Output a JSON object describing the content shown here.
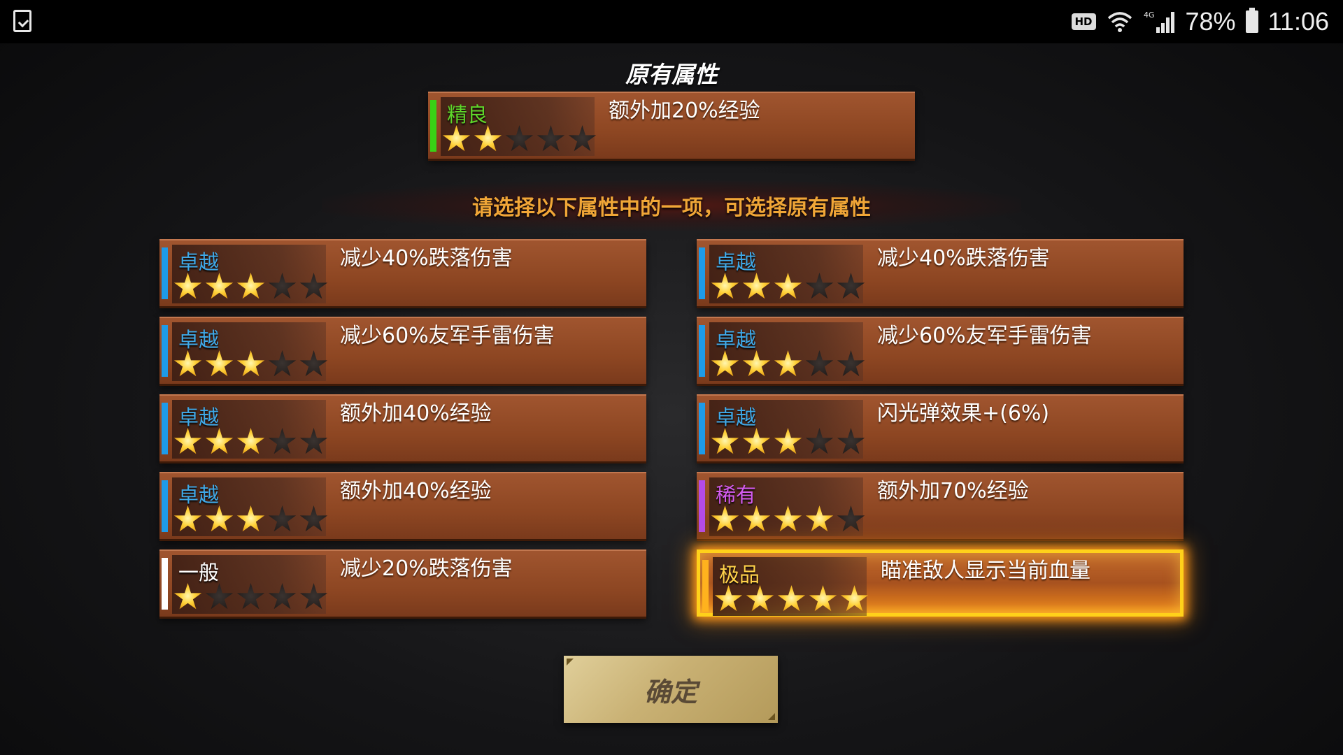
{
  "status_bar": {
    "hd": "HD",
    "network": "4G",
    "battery": "78%",
    "time": "11:06"
  },
  "original": {
    "title": "原有属性",
    "card": {
      "grade": "精良",
      "grade_color": "#5fd62a",
      "bar_color": "#39d215",
      "stars": 2,
      "desc": "额外加20%经验"
    }
  },
  "instruction": "请选择以下属性中的一项，可选择原有属性",
  "options": [
    {
      "grade": "卓越",
      "grade_color": "#3fa9e8",
      "bar_color": "#1e9be8",
      "stars": 3,
      "desc": "减少40%跌落伤害",
      "selected": false
    },
    {
      "grade": "卓越",
      "grade_color": "#3fa9e8",
      "bar_color": "#1e9be8",
      "stars": 3,
      "desc": "减少40%跌落伤害",
      "selected": false
    },
    {
      "grade": "卓越",
      "grade_color": "#3fa9e8",
      "bar_color": "#1e9be8",
      "stars": 3,
      "desc": "减少60%友军手雷伤害",
      "selected": false
    },
    {
      "grade": "卓越",
      "grade_color": "#3fa9e8",
      "bar_color": "#1e9be8",
      "stars": 3,
      "desc": "减少60%友军手雷伤害",
      "selected": false
    },
    {
      "grade": "卓越",
      "grade_color": "#3fa9e8",
      "bar_color": "#1e9be8",
      "stars": 3,
      "desc": "额外加40%经验",
      "selected": false
    },
    {
      "grade": "卓越",
      "grade_color": "#3fa9e8",
      "bar_color": "#1e9be8",
      "stars": 3,
      "desc": "闪光弹效果+(6%)",
      "selected": false
    },
    {
      "grade": "卓越",
      "grade_color": "#3fa9e8",
      "bar_color": "#1e9be8",
      "stars": 3,
      "desc": "额外加40%经验",
      "selected": false
    },
    {
      "grade": "稀有",
      "grade_color": "#d45bf0",
      "bar_color": "#b44be8",
      "stars": 4,
      "desc": "额外加70%经验",
      "selected": false
    },
    {
      "grade": "一般",
      "grade_color": "#ffffff",
      "bar_color": "#ffffff",
      "stars": 1,
      "desc": "减少20%跌落伤害",
      "selected": false
    },
    {
      "grade": "极品",
      "grade_color": "#ffd24a",
      "bar_color": "#ffb21e",
      "stars": 5,
      "desc": "瞄准敌人显示当前血量",
      "selected": true
    }
  ],
  "confirm_label": "确定"
}
